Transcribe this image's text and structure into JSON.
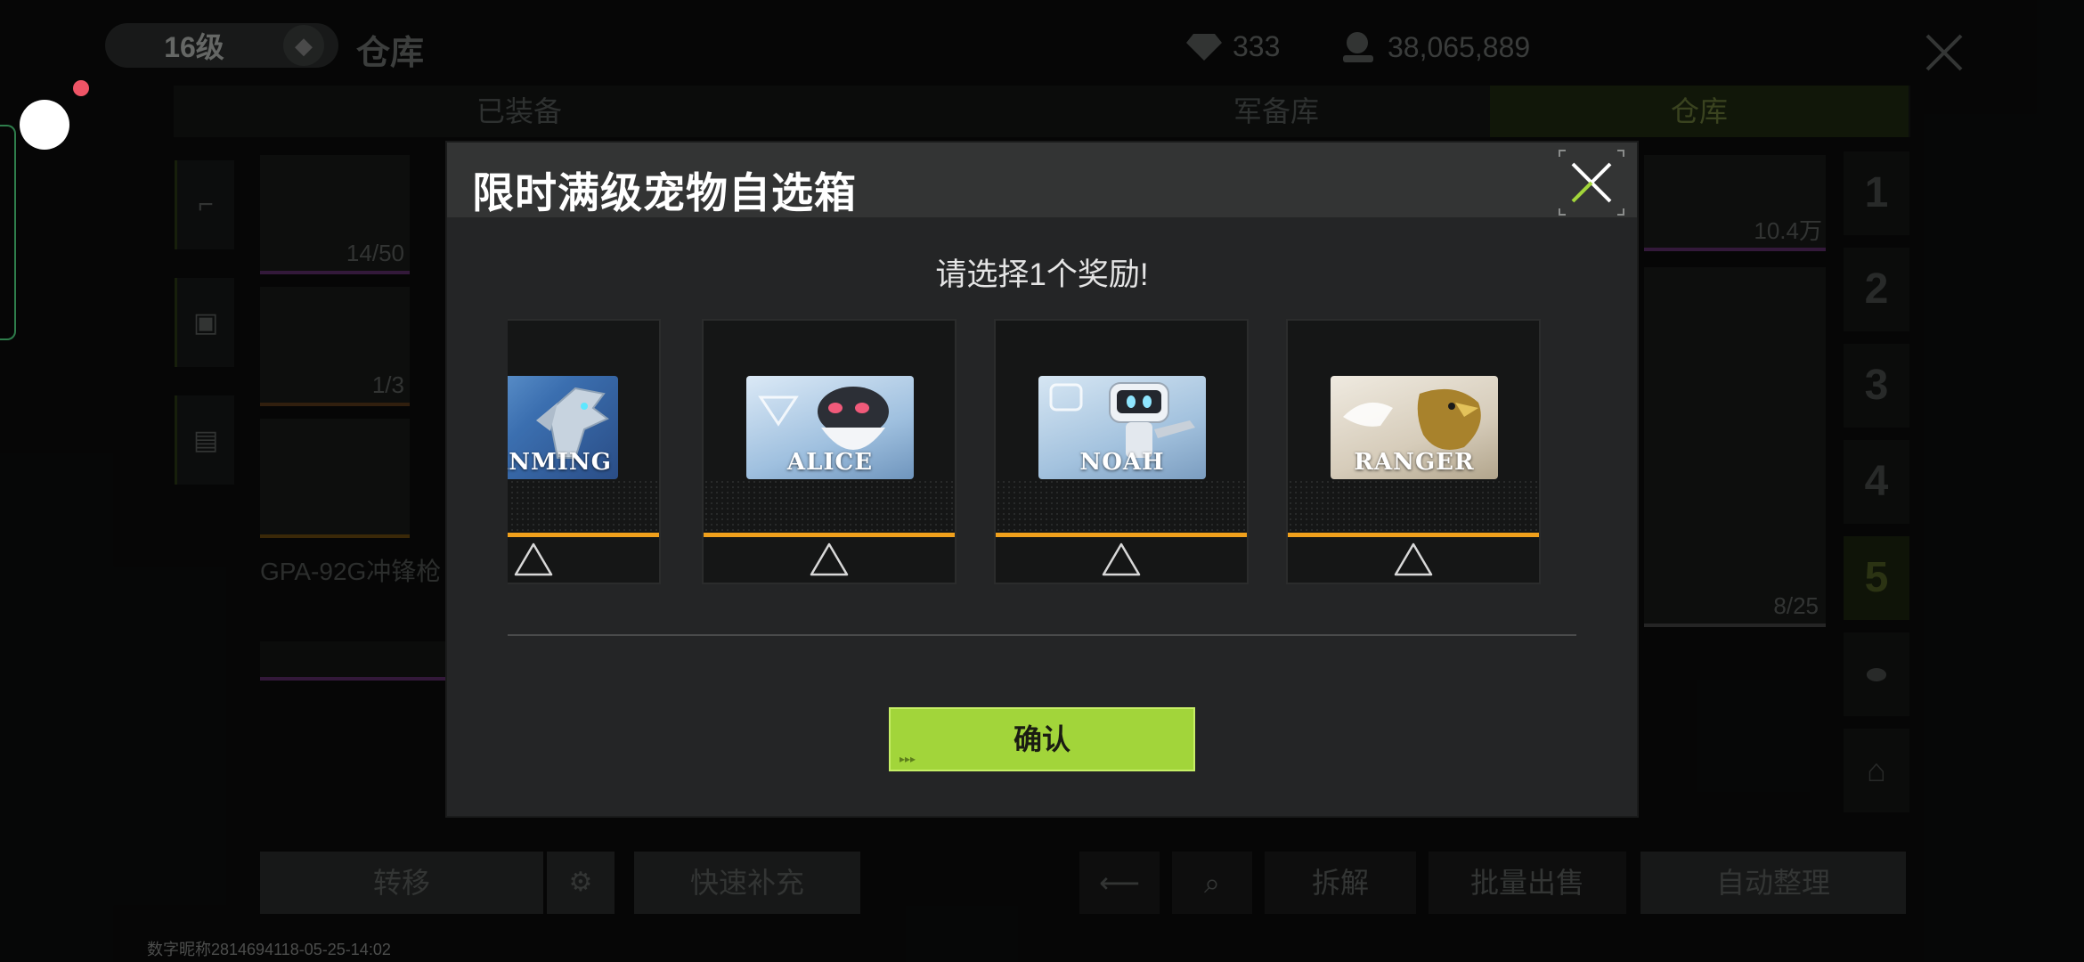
{
  "top": {
    "level": "16级",
    "page_title": "仓库",
    "diamonds": "333",
    "coins": "38,065,889"
  },
  "tabs": [
    "已装备",
    "军备库",
    "仓库"
  ],
  "inventory": {
    "counts": [
      "14/50",
      "1/3",
      "8/25"
    ],
    "price": "10.4万",
    "weapon_name": "GPA-92G冲锋枪"
  },
  "right_tabs": [
    "1",
    "2",
    "3",
    "4",
    "5"
  ],
  "bottom_buttons": {
    "transfer": "转移",
    "quick_refill": "快速补充",
    "disassemble": "拆解",
    "bulk_sell": "批量出售",
    "auto_sort": "自动整理"
  },
  "watermark": "数字昵称2814694118-05-25-14:02",
  "modal": {
    "title": "限时满级宠物自选箱",
    "subtitle": "请选择1个奖励!",
    "confirm": "确认",
    "cards": [
      {
        "name": "XUANMING"
      },
      {
        "name": "ALICE"
      },
      {
        "name": "NOAH"
      },
      {
        "name": "RANGER"
      }
    ]
  },
  "colors": {
    "accent_green": "#a2d53a",
    "rarity_orange": "#f0a01c"
  }
}
